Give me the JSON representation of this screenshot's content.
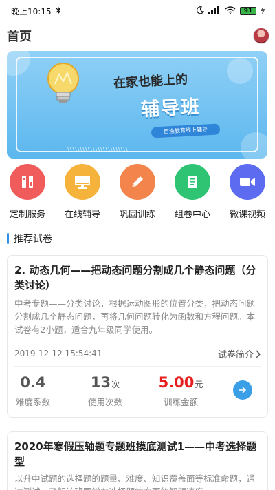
{
  "status_bar": {
    "time": "晚上10:15",
    "battery": "91"
  },
  "header": {
    "title": "首页"
  },
  "banner": {
    "headline": "在家也能上的",
    "title": "辅导班",
    "tag": "百渔教育线上辅导",
    "stripe": "\\\\\\\\\\\\\\\\\\\\\\\\\\\\\\\\\\\\\\\\\\\\\\\\"
  },
  "menu": {
    "items": [
      {
        "label": "定制服务",
        "color": "#f05c5c",
        "icon": "tools-icon"
      },
      {
        "label": "在线辅导",
        "color": "#f6b33c",
        "icon": "monitor-icon"
      },
      {
        "label": "巩固训练",
        "color": "#f3844b",
        "icon": "pencil-icon"
      },
      {
        "label": "组卷中心",
        "color": "#2fc374",
        "icon": "paper-scroll-icon"
      },
      {
        "label": "微课视频",
        "color": "#5c6bf0",
        "icon": "video-camera-icon"
      }
    ]
  },
  "section": {
    "title": "推荐试卷"
  },
  "papers": [
    {
      "title": "2. 动态几何——把动态问题分割成几个静态问题（分类讨论）",
      "desc": "中考专题——分类讨论，根据运动图形的位置分类，把动态问题分割成几个静态问题，再将几何问题转化为函数和方程问题。本试卷有2小题，适合九年级同学使用。",
      "date": "2019-12-12 15:54:41",
      "intro": "试卷简介",
      "difficulty": "0.4",
      "difficulty_label": "难度系数",
      "uses": "13",
      "uses_unit": "次",
      "uses_label": "使用次数",
      "price": "5.00",
      "price_unit": "元",
      "price_label": "训练金额"
    },
    {
      "title": "2020年寒假压轴题专题班摸底测试1——中考选择题型",
      "desc": "以升中试题的选择题的题量、难度、知识覆盖面等标准命题，通过测试，了解该班同学在选择题的方面的解题速度"
    }
  ]
}
